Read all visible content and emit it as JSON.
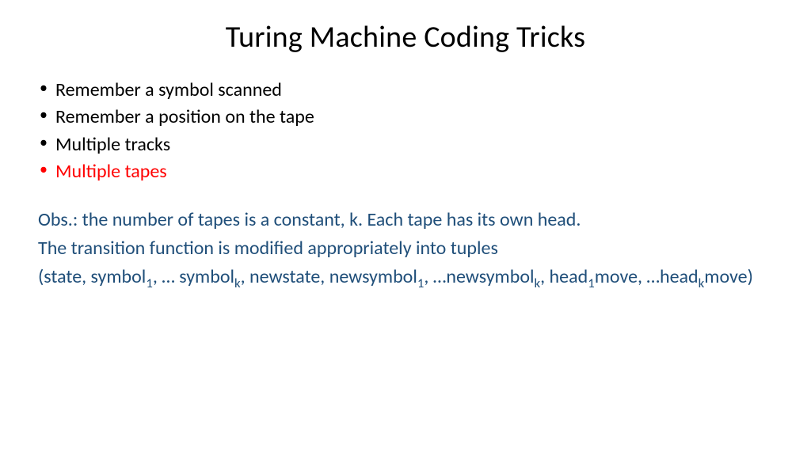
{
  "title": "Turing Machine Coding Tricks",
  "bullets": [
    {
      "text": "Remember a symbol scanned",
      "highlight": false
    },
    {
      "text": "Remember a position on the tape",
      "highlight": false
    },
    {
      "text": "Multiple tracks",
      "highlight": false
    },
    {
      "text": "Multiple tapes",
      "highlight": true
    }
  ],
  "observation": {
    "line1": "Obs.: the number of tapes is a constant, k. Each tape has its own head.",
    "line2": "The transition function is modified appropriately into tuples",
    "tuple": {
      "open": "(state, symbol",
      "s1": "1",
      "mid1": ", … symbol",
      "sk": "k",
      "mid2": ", newstate, newsymbol",
      "n1": "1",
      "mid3": ", …newsymbol",
      "nk": "k",
      "mid4": ", head",
      "h1": "1",
      "mid5": "move, …head",
      "hk": "k",
      "close": "move)"
    }
  },
  "colors": {
    "highlight": "#ff0000",
    "observation": "#1f4e79"
  }
}
